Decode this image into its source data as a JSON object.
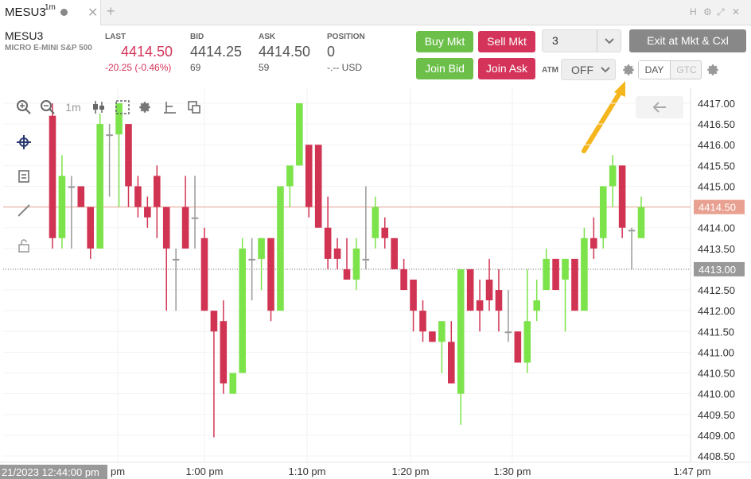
{
  "tab": {
    "title": "MESU3",
    "interval": "1m",
    "add": "+",
    "close": "✕"
  },
  "window_icons": [
    "H",
    "⚙",
    "⤢",
    "✕"
  ],
  "instrument": {
    "symbol": "MESU3",
    "description": "MICRO E-MINI S&P 500"
  },
  "quote": {
    "last_label": "LAST",
    "last": "4414.50",
    "change": "-20.25 (-0.46%)",
    "bid_label": "BID",
    "bid": "4414.25",
    "bid_size": "69",
    "ask_label": "ASK",
    "ask": "4414.50",
    "ask_size": "59",
    "position_label": "POSITION",
    "position": "0",
    "position_pnl": "-.-- USD"
  },
  "buttons": {
    "buy_mkt": "Buy Mkt",
    "sell_mkt": "Sell Mkt",
    "join_bid": "Join Bid",
    "join_ask": "Join Ask",
    "exit": "Exit at Mkt & Cxl"
  },
  "quantity": "3",
  "atm": {
    "label": "ATM",
    "value": "OFF"
  },
  "tif": {
    "day": "DAY",
    "gtc": "GTC"
  },
  "colors": {
    "up": "#7de34b",
    "down": "#d13453",
    "accent_arrow": "#f5b51d"
  },
  "chart_data": {
    "type": "candlestick",
    "interval": "1m",
    "y_ticks": [
      "4417.00",
      "4416.50",
      "4416.00",
      "4415.50",
      "4415.00",
      "4414.50",
      "4414.00",
      "4413.50",
      "4413.00",
      "4412.50",
      "4412.00",
      "4411.50",
      "4411.00",
      "4410.50",
      "4410.00",
      "4409.50",
      "4409.00",
      "4408.50"
    ],
    "ylim": [
      4408.4,
      4417.2
    ],
    "x_ticks": [
      "pm",
      "1:00 pm",
      "1:10 pm",
      "1:20 pm",
      "1:30 pm",
      "1:47 pm"
    ],
    "last_price_label": "4414.50",
    "crosshair_price_label": "4413.00",
    "crosshair_time_label": "21/2023 12:44:00 pm",
    "candles": [
      {
        "o": 4416.7,
        "h": 4417.0,
        "l": 4413.5,
        "c": 4413.75
      },
      {
        "o": 4413.75,
        "h": 4415.75,
        "l": 4413.5,
        "c": 4415.25
      },
      {
        "o": 4415.0,
        "h": 4415.25,
        "l": 4413.5,
        "c": 4415.0
      },
      {
        "o": 4415.0,
        "h": 4415.0,
        "l": 4414.5,
        "c": 4414.5
      },
      {
        "o": 4414.5,
        "h": 4414.5,
        "l": 4413.25,
        "c": 4413.5
      },
      {
        "o": 4413.5,
        "h": 4416.75,
        "l": 4413.5,
        "c": 4416.5
      },
      {
        "o": 4416.25,
        "h": 4416.5,
        "l": 4414.75,
        "c": 4416.25
      },
      {
        "o": 4416.25,
        "h": 4417.0,
        "l": 4414.5,
        "c": 4417.0
      },
      {
        "o": 4416.5,
        "h": 4416.5,
        "l": 4414.5,
        "c": 4415.0
      },
      {
        "o": 4415.0,
        "h": 4415.25,
        "l": 4414.25,
        "c": 4414.5
      },
      {
        "o": 4414.5,
        "h": 4414.75,
        "l": 4414.0,
        "c": 4414.25
      },
      {
        "o": 4415.25,
        "h": 4415.5,
        "l": 4413.75,
        "c": 4414.5
      },
      {
        "o": 4414.5,
        "h": 4414.5,
        "l": 4412.0,
        "c": 4413.5
      },
      {
        "o": 4413.25,
        "h": 4413.5,
        "l": 4412.0,
        "c": 4413.25
      },
      {
        "o": 4414.5,
        "h": 4415.25,
        "l": 4413.5,
        "c": 4413.5
      },
      {
        "o": 4414.25,
        "h": 4415.25,
        "l": 4413.5,
        "c": 4414.25
      },
      {
        "o": 4413.75,
        "h": 4414.0,
        "l": 4412.0,
        "c": 4412.0
      },
      {
        "o": 4412.0,
        "h": 4412.0,
        "l": 4408.95,
        "c": 4411.5
      },
      {
        "o": 4411.75,
        "h": 4412.25,
        "l": 4410.0,
        "c": 4410.25
      },
      {
        "o": 4410.0,
        "h": 4410.5,
        "l": 4410.0,
        "c": 4410.5
      },
      {
        "o": 4410.5,
        "h": 4413.75,
        "l": 4410.5,
        "c": 4413.5
      },
      {
        "o": 4413.25,
        "h": 4413.75,
        "l": 4412.25,
        "c": 4413.25
      },
      {
        "o": 4413.25,
        "h": 4413.75,
        "l": 4412.5,
        "c": 4413.75
      },
      {
        "o": 4413.75,
        "h": 4413.75,
        "l": 4411.75,
        "c": 4412.0
      },
      {
        "o": 4412.0,
        "h": 4415.0,
        "l": 4412.0,
        "c": 4415.0
      },
      {
        "o": 4415.0,
        "h": 4415.5,
        "l": 4414.5,
        "c": 4415.5
      },
      {
        "o": 4415.5,
        "h": 4417.0,
        "l": 4415.5,
        "c": 4417.0
      },
      {
        "o": 4416.0,
        "h": 4416.0,
        "l": 4414.25,
        "c": 4414.5
      },
      {
        "o": 4416.0,
        "h": 4416.0,
        "l": 4414.0,
        "c": 4414.0
      },
      {
        "o": 4414.0,
        "h": 4414.75,
        "l": 4413.0,
        "c": 4413.25
      },
      {
        "o": 4413.5,
        "h": 4413.75,
        "l": 4413.0,
        "c": 4413.25
      },
      {
        "o": 4413.0,
        "h": 4413.75,
        "l": 4412.75,
        "c": 4412.75
      },
      {
        "o": 4412.75,
        "h": 4413.75,
        "l": 4412.5,
        "c": 4413.5
      },
      {
        "o": 4413.25,
        "h": 4415.0,
        "l": 4413.0,
        "c": 4413.25
      },
      {
        "o": 4413.75,
        "h": 4414.75,
        "l": 4413.5,
        "c": 4414.5
      },
      {
        "o": 4414.0,
        "h": 4414.25,
        "l": 4413.5,
        "c": 4413.75
      },
      {
        "o": 4413.75,
        "h": 4413.75,
        "l": 4413.25,
        "c": 4413.0
      },
      {
        "o": 4413.0,
        "h": 4413.25,
        "l": 4412.5,
        "c": 4412.5
      },
      {
        "o": 4412.75,
        "h": 4412.75,
        "l": 4411.5,
        "c": 4412.0
      },
      {
        "o": 4412.0,
        "h": 4412.25,
        "l": 4411.25,
        "c": 4411.5
      },
      {
        "o": 4411.5,
        "h": 4411.5,
        "l": 4411.25,
        "c": 4411.25
      },
      {
        "o": 4411.25,
        "h": 4411.75,
        "l": 4410.5,
        "c": 4411.75
      },
      {
        "o": 4411.25,
        "h": 4411.75,
        "l": 4410.25,
        "c": 4410.25
      },
      {
        "o": 4410.0,
        "h": 4413.0,
        "l": 4409.25,
        "c": 4413.0
      },
      {
        "o": 4413.0,
        "h": 4413.0,
        "l": 4412.0,
        "c": 4412.0
      },
      {
        "o": 4412.25,
        "h": 4412.75,
        "l": 4411.5,
        "c": 4412.0
      },
      {
        "o": 4412.75,
        "h": 4413.25,
        "l": 4412.0,
        "c": 4412.25
      },
      {
        "o": 4412.5,
        "h": 4413.0,
        "l": 4411.5,
        "c": 4412.0
      },
      {
        "o": 4411.5,
        "h": 4412.5,
        "l": 4411.25,
        "c": 4411.5
      },
      {
        "o": 4411.5,
        "h": 4411.5,
        "l": 4410.75,
        "c": 4410.75
      },
      {
        "o": 4410.75,
        "h": 4413.0,
        "l": 4410.5,
        "c": 4411.75
      },
      {
        "o": 4412.0,
        "h": 4412.75,
        "l": 4411.75,
        "c": 4412.25
      },
      {
        "o": 4412.5,
        "h": 4413.5,
        "l": 4412.5,
        "c": 4413.25
      },
      {
        "o": 4413.25,
        "h": 4413.25,
        "l": 4412.5,
        "c": 4412.5
      },
      {
        "o": 4412.75,
        "h": 4413.25,
        "l": 4411.5,
        "c": 4413.25
      },
      {
        "o": 4413.25,
        "h": 4413.25,
        "l": 4412.0,
        "c": 4412.0
      },
      {
        "o": 4412.0,
        "h": 4414.0,
        "l": 4412.0,
        "c": 4413.75
      },
      {
        "o": 4413.75,
        "h": 4414.25,
        "l": 4413.25,
        "c": 4413.5
      },
      {
        "o": 4413.75,
        "h": 4415.0,
        "l": 4413.5,
        "c": 4415.0
      },
      {
        "o": 4415.0,
        "h": 4415.75,
        "l": 4414.5,
        "c": 4415.5
      },
      {
        "o": 4415.5,
        "h": 4415.5,
        "l": 4413.75,
        "c": 4414.0
      },
      {
        "o": 4413.95,
        "h": 4414.0,
        "l": 4413.0,
        "c": 4413.95
      },
      {
        "o": 4413.75,
        "h": 4414.75,
        "l": 4413.75,
        "c": 4414.5
      }
    ]
  }
}
